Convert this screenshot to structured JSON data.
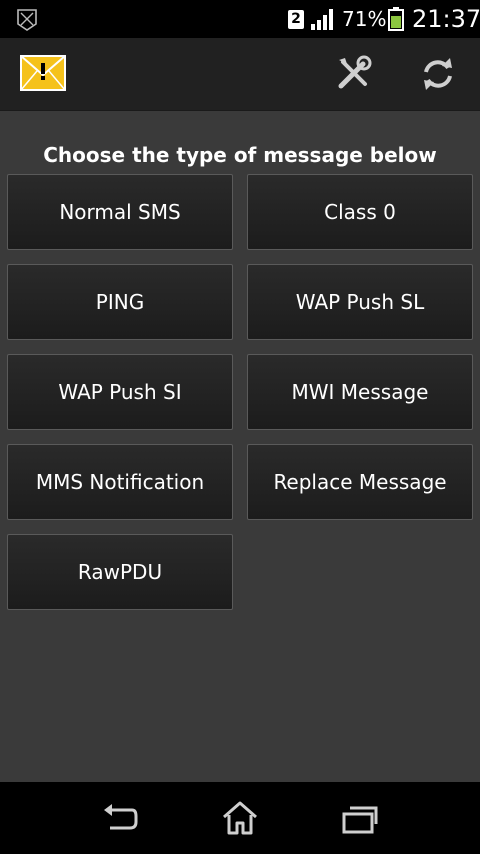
{
  "status_bar": {
    "sim_number": "2",
    "battery_percent": "71%",
    "time": "21:37",
    "icons": [
      "shield-notification-icon",
      "signal-bars-icon",
      "battery-icon"
    ]
  },
  "action_bar": {
    "icons": [
      "sms-warning-envelope-icon",
      "tools-icon",
      "refresh-icon"
    ],
    "accent_colors": {
      "envelope": "#f5c21b",
      "battery": "#8bc53f"
    }
  },
  "main": {
    "prompt": "Choose the type of message below",
    "buttons": [
      {
        "label": "Normal SMS"
      },
      {
        "label": "Class 0"
      },
      {
        "label": "PING"
      },
      {
        "label": "WAP Push SL"
      },
      {
        "label": "WAP Push SI"
      },
      {
        "label": "MWI Message"
      },
      {
        "label": "MMS Notification"
      },
      {
        "label": "Replace Message"
      },
      {
        "label": "RawPDU"
      }
    ]
  },
  "nav_bar": {
    "icons": [
      "back-icon",
      "home-icon",
      "recent-apps-icon"
    ]
  }
}
